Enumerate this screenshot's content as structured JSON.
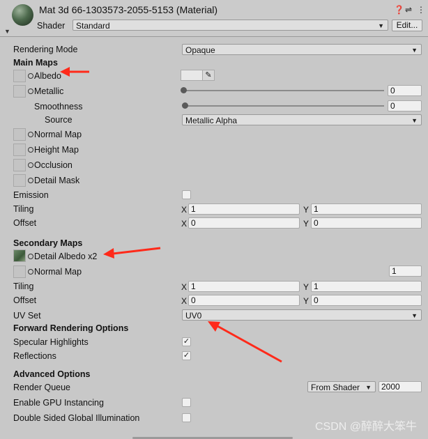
{
  "header": {
    "title": "Mat 3d 66-1303573-2055-5153 (Material)",
    "shader_label": "Shader",
    "shader_value": "Standard",
    "edit_button": "Edit..."
  },
  "rendering_mode": {
    "label": "Rendering Mode",
    "value": "Opaque"
  },
  "main_maps": {
    "heading": "Main Maps",
    "albedo": "Albedo",
    "metallic": {
      "label": "Metallic",
      "value": "0",
      "fraction": 0
    },
    "smoothness": {
      "label": "Smoothness",
      "value": "0",
      "fraction": 0
    },
    "source": {
      "label": "Source",
      "value": "Metallic Alpha"
    },
    "normal_map": "Normal Map",
    "height_map": "Height Map",
    "occlusion": "Occlusion",
    "detail_mask": "Detail Mask",
    "emission": "Emission",
    "tiling": {
      "label": "Tiling",
      "x": "1",
      "y": "1"
    },
    "offset": {
      "label": "Offset",
      "x": "0",
      "y": "0"
    }
  },
  "secondary_maps": {
    "heading": "Secondary Maps",
    "detail_albedo": "Detail Albedo x2",
    "normal_map": "Normal Map",
    "normal_value": "1",
    "tiling": {
      "label": "Tiling",
      "x": "1",
      "y": "1"
    },
    "offset": {
      "label": "Offset",
      "x": "0",
      "y": "0"
    },
    "uv_set": {
      "label": "UV Set",
      "value": "UV0"
    }
  },
  "forward": {
    "heading": "Forward Rendering Options",
    "specular": "Specular Highlights",
    "reflections": "Reflections"
  },
  "advanced": {
    "heading": "Advanced Options",
    "render_queue": {
      "label": "Render Queue",
      "mode": "From Shader",
      "value": "2000"
    },
    "gpu_instancing": "Enable GPU Instancing",
    "double_sided": "Double Sided Global Illumination"
  },
  "axis": {
    "x": "X",
    "y": "Y"
  },
  "watermark": "CSDN @醉醉大笨牛",
  "colors": {
    "annotation_arrow": "#ff2a1a"
  }
}
